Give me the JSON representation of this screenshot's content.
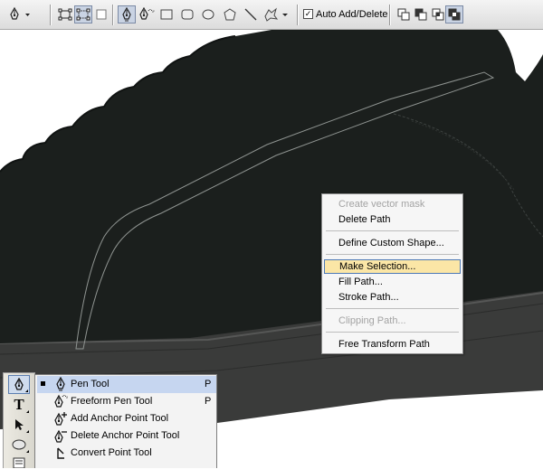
{
  "options_bar": {
    "auto_add_delete": {
      "label": "Auto Add/Delete",
      "checked": true
    }
  },
  "context_menu": {
    "items": [
      {
        "label": "Create vector mask",
        "enabled": false
      },
      {
        "label": "Delete Path",
        "enabled": true
      },
      {
        "label": "Define Custom Shape...",
        "enabled": true
      },
      {
        "label": "Make Selection...",
        "enabled": true,
        "highlighted": true
      },
      {
        "label": "Fill Path...",
        "enabled": true
      },
      {
        "label": "Stroke Path...",
        "enabled": true
      },
      {
        "label": "Clipping Path...",
        "enabled": false
      },
      {
        "label": "Free Transform Path",
        "enabled": true
      }
    ]
  },
  "tools_panel": {
    "type_tool_glyph": "T"
  },
  "pen_flyout": {
    "items": [
      {
        "label": "Pen Tool",
        "shortcut": "P",
        "active": true,
        "icon": "pen-icon"
      },
      {
        "label": "Freeform Pen Tool",
        "shortcut": "P",
        "icon": "freeform-pen-icon"
      },
      {
        "label": "Add Anchor Point Tool",
        "shortcut": "",
        "icon": "add-anchor-point-icon"
      },
      {
        "label": "Delete Anchor Point Tool",
        "shortcut": "",
        "icon": "delete-anchor-point-icon"
      },
      {
        "label": "Convert Point Tool",
        "shortcut": "",
        "icon": "convert-point-icon"
      }
    ]
  },
  "colors": {
    "shoe_body": "#1b1f1d",
    "sole": "#3a3b3a",
    "menu_highlight": "#fbe6a6",
    "menu_highlight_border": "#4d79b5",
    "path_stroke": "#8f9491"
  }
}
